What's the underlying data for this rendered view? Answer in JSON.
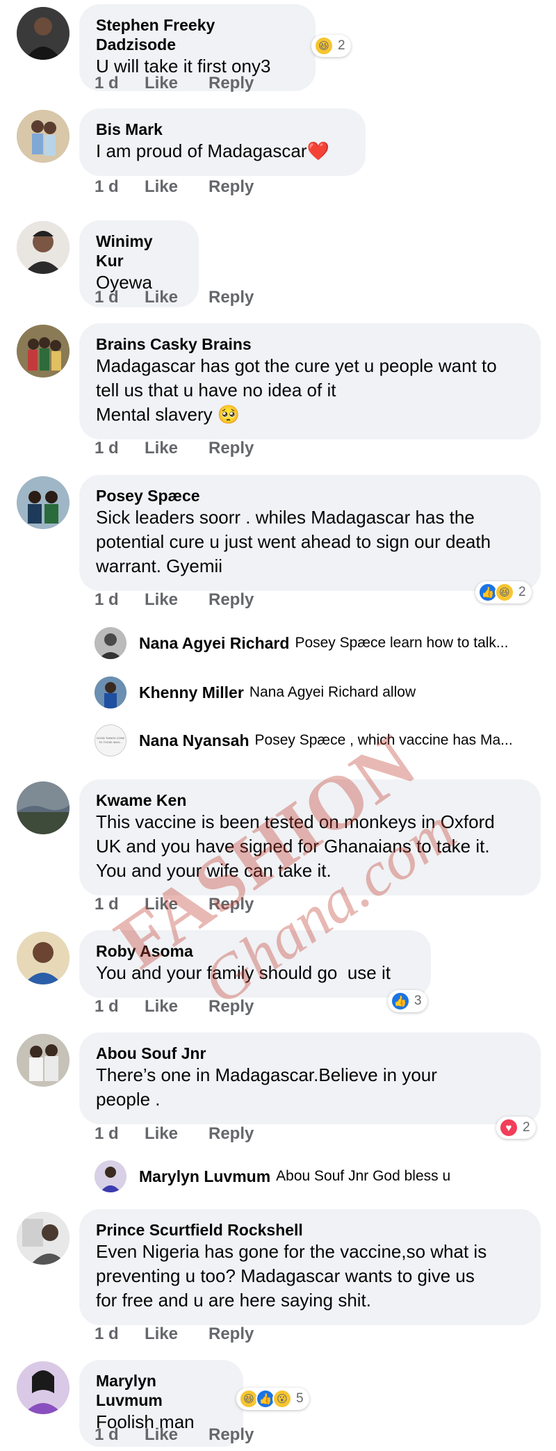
{
  "comments": [
    {
      "name": "Stephen Freeky Dadzisode",
      "text": "U will take it first ony3",
      "time": "1 d",
      "like": "Like",
      "reply": "Reply",
      "reactions": {
        "icons": [
          "haha"
        ],
        "count": "2"
      }
    },
    {
      "name": "Bis Mark",
      "text": "I am proud of Madagascar❤️",
      "time": "1 d",
      "like": "Like",
      "reply": "Reply"
    },
    {
      "name": "Winimy Kur",
      "text": "Oyewa",
      "time": "1 d",
      "like": "Like",
      "reply": "Reply"
    },
    {
      "name": "Brains Casky Brains",
      "text": "Madagascar has got the cure yet u people want to\ntell us that u have no idea of it\nMental slavery 🥺",
      "time": "1 d",
      "like": "Like",
      "reply": "Reply"
    },
    {
      "name": "Posey Spæce",
      "text": "Sick leaders soorr . whiles Madagascar has the\npotential cure u just went ahead to sign our death\nwarrant. Gyemii",
      "time": "1 d",
      "like": "Like",
      "reply": "Reply",
      "reactions": {
        "icons": [
          "like",
          "haha"
        ],
        "count": "2"
      },
      "replies": [
        {
          "name": "Nana Agyei Richard",
          "text": "Posey Spæce learn how to talk..."
        },
        {
          "name": "Khenny Miller",
          "text": "Nana Agyei Richard allow"
        },
        {
          "name": "Nana Nyansah",
          "text": "Posey Spæce , which vaccine has Ma..."
        }
      ]
    },
    {
      "name": "Kwame Ken",
      "text": "This vaccine is been tested on monkeys in Oxford\nUK and you have signed for Ghanaians to take it.\nYou and your wife can take it.",
      "time": "1 d",
      "like": "Like",
      "reply": "Reply"
    },
    {
      "name": "Roby Asoma",
      "text": "You and your family should go  use it",
      "time": "1 d",
      "like": "Like",
      "reply": "Reply",
      "reactions": {
        "icons": [
          "like"
        ],
        "count": "3"
      }
    },
    {
      "name": "Abou Souf Jnr",
      "text": "There’s one in Madagascar.Believe in your\npeople .",
      "time": "1 d",
      "like": "Like",
      "reply": "Reply",
      "reactions": {
        "icons": [
          "love"
        ],
        "count": "2"
      },
      "replies": [
        {
          "name": "Marylyn Luvmum",
          "text": "Abou Souf Jnr God bless u"
        }
      ]
    },
    {
      "name": "Prince Scurtfield Rockshell",
      "text": "Even Nigeria has gone for the vaccine,so what is\npreventing u too? Madagascar wants to give us\nfor free and u are here saying shit.",
      "time": "1 d",
      "like": "Like",
      "reply": "Reply"
    },
    {
      "name": "Marylyn Luvmum",
      "text": "Foolish man",
      "time": "1 d",
      "like": "Like",
      "reply": "Reply",
      "reactions": {
        "icons": [
          "haha",
          "like",
          "wow"
        ],
        "count": "5"
      }
    }
  ],
  "reply_avatar_badge": "GOOD THINGS COME TO THOSE WHO...",
  "watermark": {
    "line1": "FASHION",
    "line2": "Ghana.com"
  },
  "colors": {
    "bubble": "#f0f2f5",
    "meta": "#65676b",
    "like_blue": "#1b74e4",
    "love_red": "#f33e58",
    "haha_yellow": "#f7c531",
    "watermark": "#c0392b"
  }
}
